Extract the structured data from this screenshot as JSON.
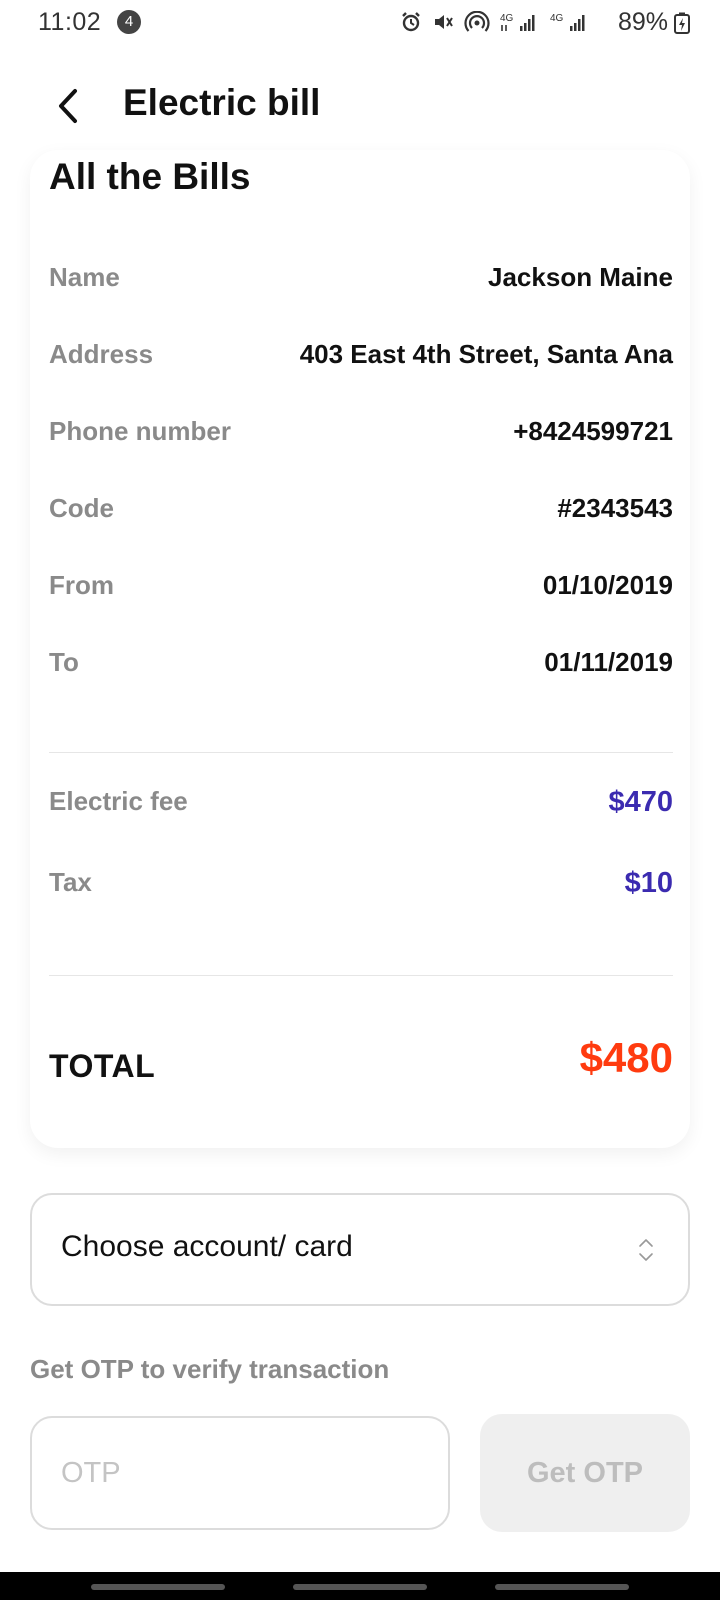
{
  "status_bar": {
    "time": "11:02",
    "notification_count": "4",
    "battery": "89%"
  },
  "header": {
    "title": "Electric bill"
  },
  "bill": {
    "title": "All the Bills",
    "details": [
      {
        "label": "Name",
        "value": "Jackson Maine"
      },
      {
        "label": "Address",
        "value": "403 East 4th Street, Santa Ana"
      },
      {
        "label": "Phone number",
        "value": "+8424599721"
      },
      {
        "label": "Code",
        "value": "#2343543"
      },
      {
        "label": "From",
        "value": "01/10/2019"
      },
      {
        "label": "To",
        "value": "01/11/2019"
      }
    ],
    "fees": [
      {
        "label": "Electric fee",
        "value": "$470"
      },
      {
        "label": "Tax",
        "value": "$10"
      }
    ],
    "total_label": "TOTAL",
    "total_value": "$480"
  },
  "account_select": {
    "label": "Choose account/ card"
  },
  "otp": {
    "caption": "Get OTP to verify transaction",
    "placeholder": "OTP",
    "button_label": "Get OTP"
  },
  "colors": {
    "accent": "#3b2bb0",
    "total": "#ff3b0f",
    "muted_label": "#8a8a8a"
  }
}
